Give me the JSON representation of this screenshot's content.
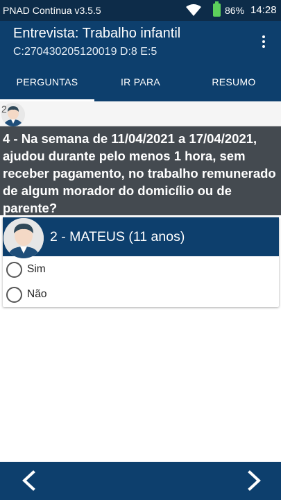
{
  "status_bar": {
    "app_version": "PNAD Contínua v3.5.5",
    "battery_percent": "86%",
    "time": "14:28",
    "icons": [
      "wifi-icon",
      "battery-icon"
    ]
  },
  "app_bar": {
    "title": "Entrevista: Trabalho infantil",
    "subtitle": "C:270430205120019 D:8 E:5",
    "menu_icon": "more-vert-icon"
  },
  "tabs": [
    {
      "label": "PERGUNTAS",
      "active": true
    },
    {
      "label": "IR PARA",
      "active": false
    },
    {
      "label": "RESUMO",
      "active": false
    }
  ],
  "progress": {
    "number": "2"
  },
  "question": {
    "text": "4 - Na semana de 11/04/2021 a 17/04/2021, ajudou durante pelo menos 1 hora, sem receber pagamento, no trabalho remunerado de algum morador do domicílio ou de parente?"
  },
  "person_card": {
    "name": "2 - MATEUS (11 anos)",
    "options": [
      {
        "label": "Sim",
        "selected": false
      },
      {
        "label": "Não",
        "selected": false
      }
    ]
  },
  "bottom_nav": {
    "prev_icon": "chevron-left-icon",
    "next_icon": "chevron-right-icon"
  },
  "colors": {
    "status_bar": "#0d2c49",
    "primary": "#0d3f6d",
    "question_bg": "#444a50",
    "battery": "#5cd05c"
  }
}
